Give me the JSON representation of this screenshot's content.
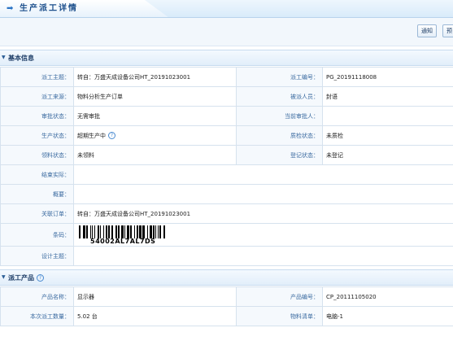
{
  "header": {
    "title": "生产派工详情",
    "arrow_icon": "arrow-right-icon"
  },
  "toolbar": {
    "notify_label": "通知",
    "second_label": "预"
  },
  "basic": {
    "section_title": "基本信息",
    "rows": [
      [
        {
          "label": "派工主题：",
          "value": "转自：万盛天成设备公司HT_20191023001"
        },
        {
          "label": "派工编号：",
          "value": "PG_20191118008"
        }
      ],
      [
        {
          "label": "派工来源：",
          "value": "物料分析生产订单"
        },
        {
          "label": "被派人员：",
          "value": "封语"
        }
      ],
      [
        {
          "label": "审批状态：",
          "value": "无需审批"
        },
        {
          "label": "当前审批人：",
          "value": ""
        }
      ],
      [
        {
          "label": "生产状态：",
          "value": "超期生产中"
        },
        {
          "label": "质检状态：",
          "value": "未质检"
        }
      ],
      [
        {
          "label": "领料状态：",
          "value": "未领料"
        },
        {
          "label": "登记状态：",
          "value": "未登记"
        }
      ]
    ],
    "end_actual_label": "结束实际：",
    "end_actual_value": "",
    "summary_label": "概要：",
    "summary_value": "",
    "related_order_label": "关联订单：",
    "related_order_value": "转自：万盛天成设备公司HT_20191023001",
    "barcode_label": "条码：",
    "barcode_text": "54002AL7AL7DS",
    "design_label": "设计主题：",
    "design_value": ""
  },
  "product": {
    "section_title": "派工产品",
    "rows": [
      [
        {
          "label": "产品名称：",
          "value": "显示器"
        },
        {
          "label": "产品编号：",
          "value": "CP_20111105020"
        }
      ],
      [
        {
          "label": "本次派工数量：",
          "value": "5.02 台"
        },
        {
          "label": "物料清单：",
          "value": "电脑-1"
        }
      ]
    ]
  },
  "colors": {
    "label_text": "#3a6aa0",
    "border": "#d6e2ee",
    "header_bg": "#e2eefa",
    "help_icon": "#4a8bd0"
  }
}
